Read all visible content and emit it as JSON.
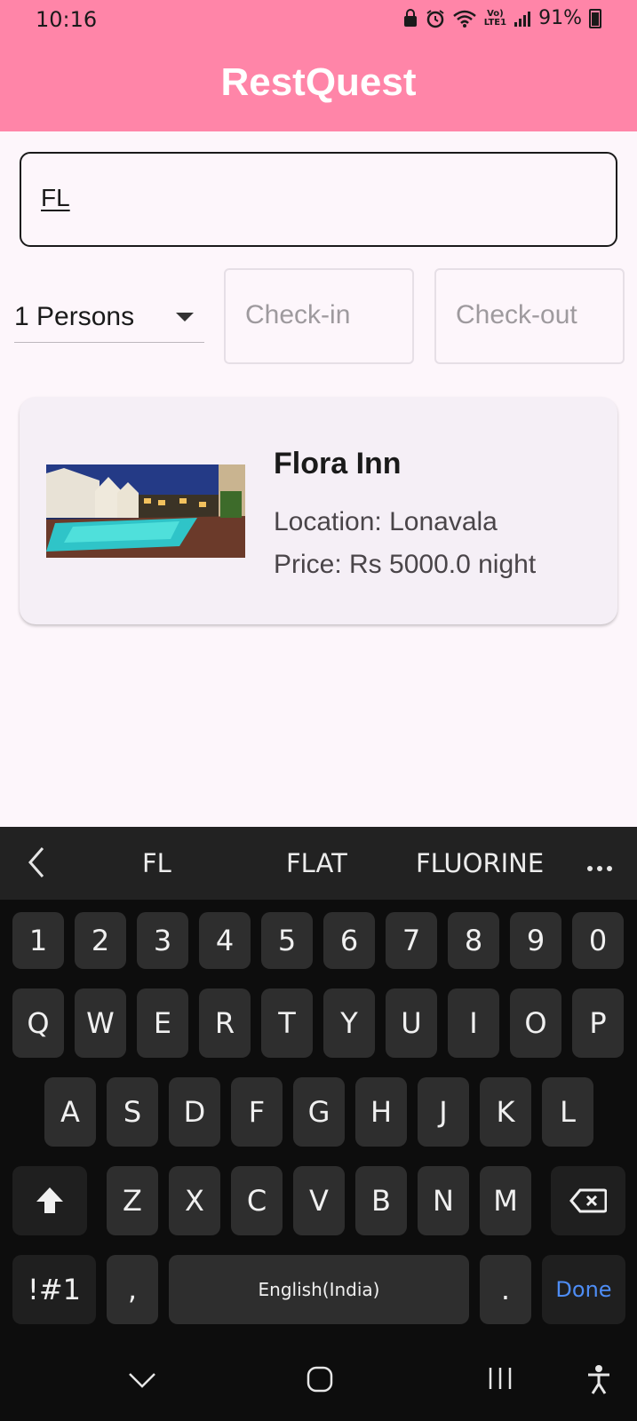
{
  "status": {
    "time": "10:16",
    "battery": "91%",
    "lte_top": "Vo)",
    "lte_bottom": "LTE1"
  },
  "app": {
    "title": "RestQuest"
  },
  "search": {
    "value": "FL"
  },
  "filters": {
    "persons": "1 Persons",
    "checkin_placeholder": "Check-in",
    "checkout_placeholder": "Check-out"
  },
  "results": [
    {
      "name": "Flora Inn",
      "location": "Location: Lonavala",
      "price": "Price: Rs 5000.0 night"
    }
  ],
  "keyboard": {
    "suggestions": [
      "FL",
      "FLAT",
      "FLUORINE"
    ],
    "numbers": [
      "1",
      "2",
      "3",
      "4",
      "5",
      "6",
      "7",
      "8",
      "9",
      "0"
    ],
    "row1": [
      "Q",
      "W",
      "E",
      "R",
      "T",
      "Y",
      "U",
      "I",
      "O",
      "P"
    ],
    "row2": [
      "A",
      "S",
      "D",
      "F",
      "G",
      "H",
      "J",
      "K",
      "L"
    ],
    "row3": [
      "Z",
      "X",
      "C",
      "V",
      "B",
      "N",
      "M"
    ],
    "symbols_label": "!#1",
    "comma": ",",
    "space_label": "English(India)",
    "period": ".",
    "done_label": "Done"
  },
  "colors": {
    "app_bar": "#ff85a8",
    "keyboard_bg": "#0d0d0d",
    "key_bg": "#2e2e2e",
    "done": "#4e8df5"
  }
}
